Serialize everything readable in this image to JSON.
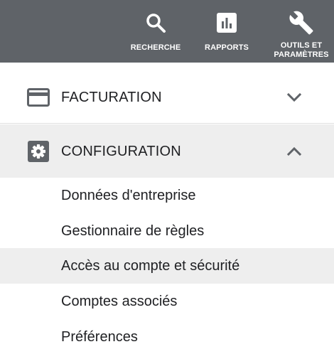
{
  "header": {
    "tools": [
      {
        "label": "RECHERCHE",
        "icon": "search-icon"
      },
      {
        "label": "RAPPORTS",
        "icon": "reports-icon"
      },
      {
        "label": "OUTILS ET\nPARAMÈTRES",
        "icon": "wrench-icon"
      }
    ]
  },
  "menu": {
    "sections": [
      {
        "title": "FACTURATION",
        "icon": "credit-card-icon",
        "expanded": false,
        "chevron": "chevron-down-icon"
      },
      {
        "title": "CONFIGURATION",
        "icon": "gear-icon",
        "expanded": true,
        "chevron": "chevron-up-icon"
      }
    ],
    "config_items": [
      {
        "label": "Données d'entreprise"
      },
      {
        "label": "Gestionnaire de règles"
      },
      {
        "label": "Accès au compte et sécurité",
        "selected": true
      },
      {
        "label": "Comptes associés"
      },
      {
        "label": "Préférences"
      }
    ]
  },
  "colors": {
    "header_bg": "#5f6368",
    "selected_bg": "#eeeeee",
    "text": "#202124",
    "icon": "#5f6368"
  }
}
